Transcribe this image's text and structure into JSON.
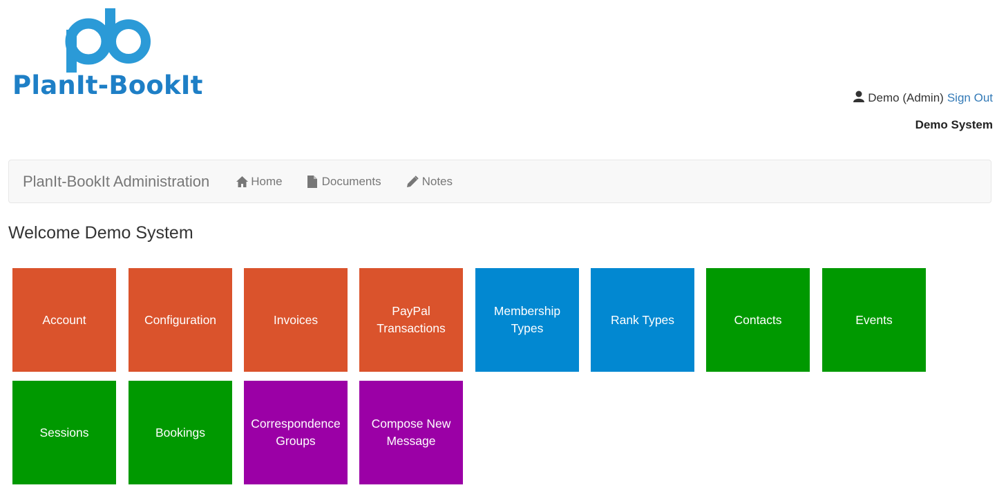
{
  "logo": {
    "text": "PlanIt-BookIt",
    "color": "#2b9ad7"
  },
  "user": {
    "name": "Demo (Admin)",
    "signout_label": "Sign Out",
    "icon": "user-icon"
  },
  "system_name": "Demo System",
  "navbar": {
    "brand": "PlanIt-BookIt Administration",
    "items": [
      {
        "label": "Home",
        "icon": "home-icon"
      },
      {
        "label": "Documents",
        "icon": "file-icon"
      },
      {
        "label": "Notes",
        "icon": "pencil-icon"
      }
    ]
  },
  "welcome": "Welcome Demo System",
  "colors": {
    "orange": "#da532c",
    "blue": "#0288d1",
    "green": "#009900",
    "purple": "#9b00a6"
  },
  "tiles": [
    {
      "lines": [
        "Account"
      ],
      "color": "orange"
    },
    {
      "lines": [
        "Configuration"
      ],
      "color": "orange"
    },
    {
      "lines": [
        "Invoices"
      ],
      "color": "orange"
    },
    {
      "lines": [
        "PayPal",
        "Transactions"
      ],
      "color": "orange"
    },
    {
      "lines": [
        "Membership",
        "Types"
      ],
      "color": "blue"
    },
    {
      "lines": [
        "Rank Types"
      ],
      "color": "blue"
    },
    {
      "lines": [
        "Contacts"
      ],
      "color": "green"
    },
    {
      "lines": [
        "Events"
      ],
      "color": "green"
    },
    {
      "lines": [
        "Sessions"
      ],
      "color": "green"
    },
    {
      "lines": [
        "Bookings"
      ],
      "color": "green"
    },
    {
      "lines": [
        "Correspondence",
        "Groups"
      ],
      "color": "purple"
    },
    {
      "lines": [
        "Compose New",
        "Message"
      ],
      "color": "purple"
    }
  ]
}
